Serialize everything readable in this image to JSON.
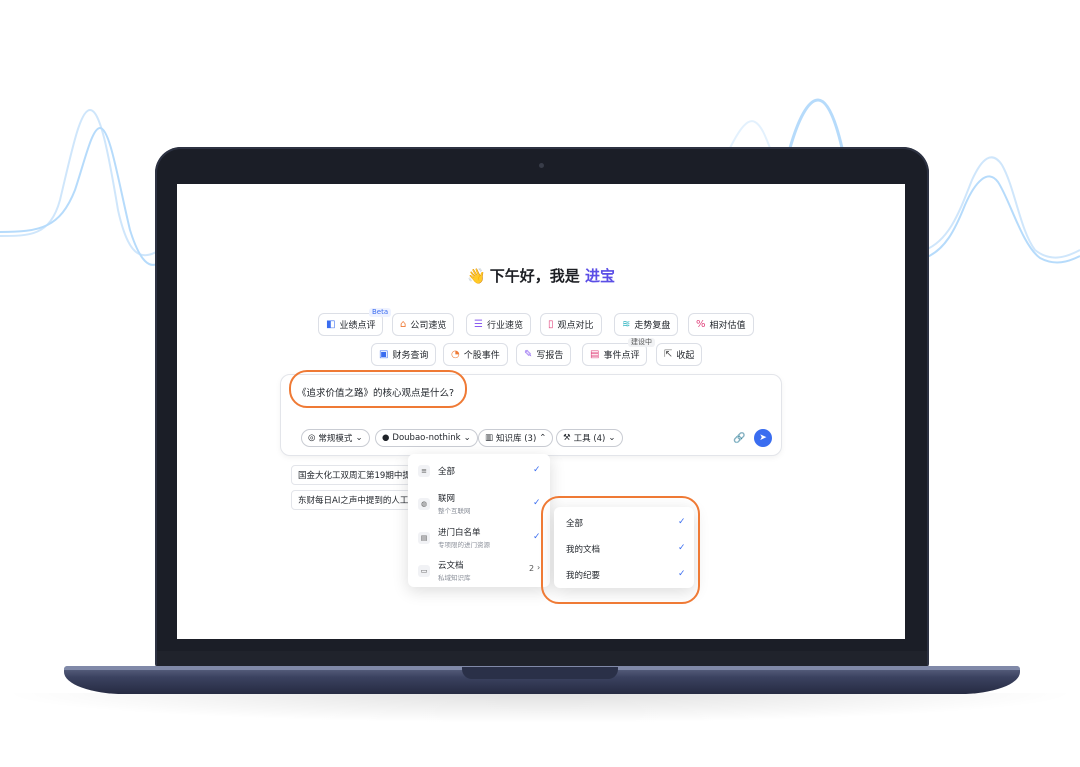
{
  "greeting": {
    "text": "下午好，我是 ",
    "brand": "进宝"
  },
  "colors": {
    "accent": "#3a6df0",
    "brand": "#5b4ee6",
    "highlight_ring": "#ef7a35"
  },
  "features": {
    "row1": [
      {
        "label": "业绩点评",
        "icon": "report-icon",
        "badge": "Beta"
      },
      {
        "label": "公司速览",
        "icon": "building-icon"
      },
      {
        "label": "行业速览",
        "icon": "industry-icon"
      },
      {
        "label": "观点对比",
        "icon": "compare-icon"
      },
      {
        "label": "走势复盘",
        "icon": "trend-icon"
      },
      {
        "label": "相对估值",
        "icon": "percent-icon"
      }
    ],
    "row2": [
      {
        "label": "财务查询",
        "icon": "finance-icon"
      },
      {
        "label": "个股事件",
        "icon": "event-icon"
      },
      {
        "label": "写报告",
        "icon": "write-icon"
      },
      {
        "label": "事件点评",
        "icon": "comment-icon",
        "badge": "建设中"
      },
      {
        "label": "收起",
        "icon": "collapse-icon"
      }
    ]
  },
  "composer": {
    "query": "《追求价值之路》的核心观点是什么?",
    "mode": "常规模式",
    "model": "Doubao-nothink",
    "knowledge": "知识库 (3)",
    "tools": "工具 (4)"
  },
  "suggestions": [
    "国金大化工双周汇第19期中提",
    "东财每日AI之声中提到的人工"
  ],
  "kb_menu": {
    "items": [
      {
        "title": "全部",
        "subtitle": "",
        "checked": true
      },
      {
        "title": "联网",
        "subtitle": "整个互联网",
        "checked": true
      },
      {
        "title": "进门白名单",
        "subtitle": "专项限的进门资源",
        "checked": true
      },
      {
        "title": "云文档",
        "subtitle": "私域知识库",
        "count": "2",
        "checked": false
      }
    ]
  },
  "cloud_submenu": {
    "items": [
      {
        "title": "全部",
        "checked": true
      },
      {
        "title": "我的文档",
        "checked": true
      },
      {
        "title": "我的纪要",
        "checked": true
      }
    ]
  }
}
